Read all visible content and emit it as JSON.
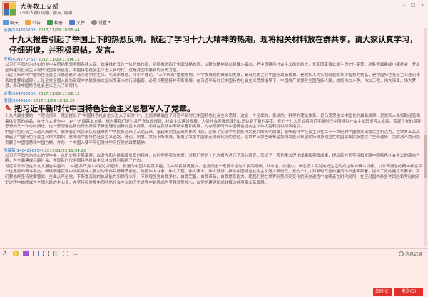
{
  "window": {
    "title": "大美教工支部",
    "subtitle": "(300人群) 同事, 朋友, 同事"
  },
  "toolbar": {
    "items": [
      {
        "label": "聊天",
        "icon": "chat-icon",
        "color": "#4f9be0"
      },
      {
        "label": "公告",
        "icon": "announce-icon",
        "color": "#f1a23a"
      },
      {
        "label": "相册",
        "icon": "album-icon",
        "color": "#3f9e4f"
      },
      {
        "label": "文件",
        "icon": "folder-icon",
        "color": "#4a7fc7"
      },
      {
        "label": "设置",
        "icon": "settings-icon",
        "color": "#888888"
      }
    ]
  },
  "messages": [
    {
      "id": "m1",
      "sender": "谈婆(524765002)",
      "time": "2017/11/29 10:55:44",
      "style": "big",
      "text": "十九大报告引起了举国上下的热烈反响，掀起了学习十九大精神的热潮，现将相关材料放在群共享，请大家认真学习，仔细研读，并积极跟帖，发言。"
    },
    {
      "id": "m2",
      "sender": "王明(609270762)",
      "time": "2017/11/29 11:04:11",
      "style": "normal",
      "text": "以习近平同志为核心的党中央团结带领全国各族人民，统筹推进五位一体总体布局、协调推进四个全面战略布局，以新的精神状态和奋斗姿态，把中国特色社会主义推向前进，党和国家事业发生历史性变革，决胜全面建成小康社会，开启全面建设社会主义现代化国家新征程，中国特色社会主义进入新时代，这是我国发展新的历史方位。"
    },
    {
      "id": "m3",
      "sender": "",
      "time": "",
      "style": "normal",
      "text": "习近平新时代中国特色社会主义思想是对马克思列宁主义、毛泽东思想、邓小平理论、“三个代表”重要思想、科学发展观的继承和发展，是马克思主义中国化最新成果，是党和人民实践经验和集体智慧的结晶，是中国特色社会主义理论体系的重要组成部分，是全党全国人民为实现中华民族伟大复兴而奋斗的行动指南，必须长期坚持并不断发展。在习近平新时代中国特色社会主义思想指导下，中国共产党领导全国各族人民，统揽伟大斗争、伟大工程、伟大事业、伟大梦想，推动中国特色社会主义进入了新时代。"
    },
    {
      "id": "m4",
      "sender": "谈婆(524765002)",
      "time": "2017/11/29 11:08:12",
      "style": "spacer",
      "text": ""
    },
    {
      "id": "m5",
      "sender": "雨荷(5249310)",
      "time": "2017/11/29 18:16:20",
      "style": "heading",
      "text": "把习近平新时代中国特色社会主义思想写入了党章。"
    },
    {
      "id": "m6",
      "sender": "",
      "time": "",
      "style": "normal",
      "text": "十九大最主要的一个理论创新，就是提出了“中国特色社会主义进入了新时代”，进而明确确立了习近平新时代中国特色社会主义思想，这是一个全面的、系统的、科学的理论体系，是马克思主义中国化的最新成果，是党和人民实践经验和集体智慧的结晶。在十九大报告中，14个方面基本方略，标志着我们党对共产党执政规律、社会主义建设规律、人类社会发展规律的认识达到了新的高度。党的十九大正式将习近平新时代中国特色社会主义思想写入党章，实现了党的指导思想的又一次与时俱进。这一思想是在新的历史条件下推进理论创新的重大成果，必将在实践中不断丰富和发展，为夺取新时代中国特色社会主义伟大胜利提供科学指引。"
    },
    {
      "id": "m7",
      "sender": "",
      "time": "",
      "style": "normal",
      "text": "中国特色社会主义进入新时代，意味着近代以来久经磨难的中华民族迎来了从站起来、富起来到强起来的伟大飞跃，迎来了实现中华民族伟大复兴的光明前景；意味着科学社会主义在二十一世纪的中国焕发出强大生机活力，在世界上高高举起了中国特色社会主义伟大旗帜；意味着中国特色社会主义道路、理论、制度、文化不断发展，拓展了发展中国家走向现代化的途径，给世界上那些既希望加快发展又希望保持自身独立性的国家和民族提供了全新选择，为解决人类问题贡献了中国智慧和中国方案。作为一个中国人要牢牢记得并学习好党的政策精神。"
    },
    {
      "id": "m8",
      "sender": "殷薇薇(1404298954)",
      "time": "2017/11/29 19:54:20",
      "style": "normal",
      "text": "以习近平同志为核心的党中央，从历史和全局高度，以对党和人民高度负责的精神，以科学务实的态度，对我们党的十九大报告进行了深入研究，形成了一系列重大理论成果和实践成果，提出新时代坚持和发展中国特色社会主义的基本方略，为全面建成小康社会、夺取新时代中国特色社会主义伟大胜利指明了方向。"
    },
    {
      "id": "m9",
      "sender": "",
      "time": "",
      "style": "normal",
      "text": "习近平总书记在十九大报告中指出：“中国共产党人的初心和使命，就是为中国人民谋幸福，为中华民族谋复兴。”全党同志一定要永远与人民同呼吸、共命运、心连心，永远把人民对美好生活的向往作为奋斗目标，以永不懈怠的精神状态和一往无前的奋斗姿态，继续朝着实现中华民族伟大复兴的宏伟目标奋勇前进。统揽伟大斗争、伟大工程、伟大事业、伟大梦想，推动中国特色社会主义进入新时代，党的十九大对新时代党的建设作出全面部署，提出了党的建设总要求，我们要始终坚持党要管党、全面从严治党，不断提高党的执政能力和领导水平，不断增强党自我净化、自我完善、自我革新、自我提高能力，使我们党在世界形势深刻变化的历史进程中始终走在时代前列，在应对国内外各种风险和考验的历史进程中始终成为全国人民的主心骨，在坚持和发展中国特色社会主义的历史进程中始终成为坚强领导核心，以党的建设新成效推动各项事业新发展。"
    }
  ],
  "input_toolbar": {
    "icons": [
      {
        "icon": "font-icon"
      },
      {
        "icon": "emoji-icon"
      },
      {
        "icon": "magic-icon"
      },
      {
        "icon": "image-icon"
      },
      {
        "icon": "screenshot-icon"
      },
      {
        "icon": "file-icon"
      },
      {
        "icon": "voice-icon"
      },
      {
        "icon": "more-icon"
      }
    ],
    "history_label": "消息记录"
  },
  "buttons": {
    "close_label": "关闭(C)",
    "send_label": "发送(S)"
  },
  "colors": {
    "accent": "#e0302b",
    "sender": "#2e7d32"
  }
}
